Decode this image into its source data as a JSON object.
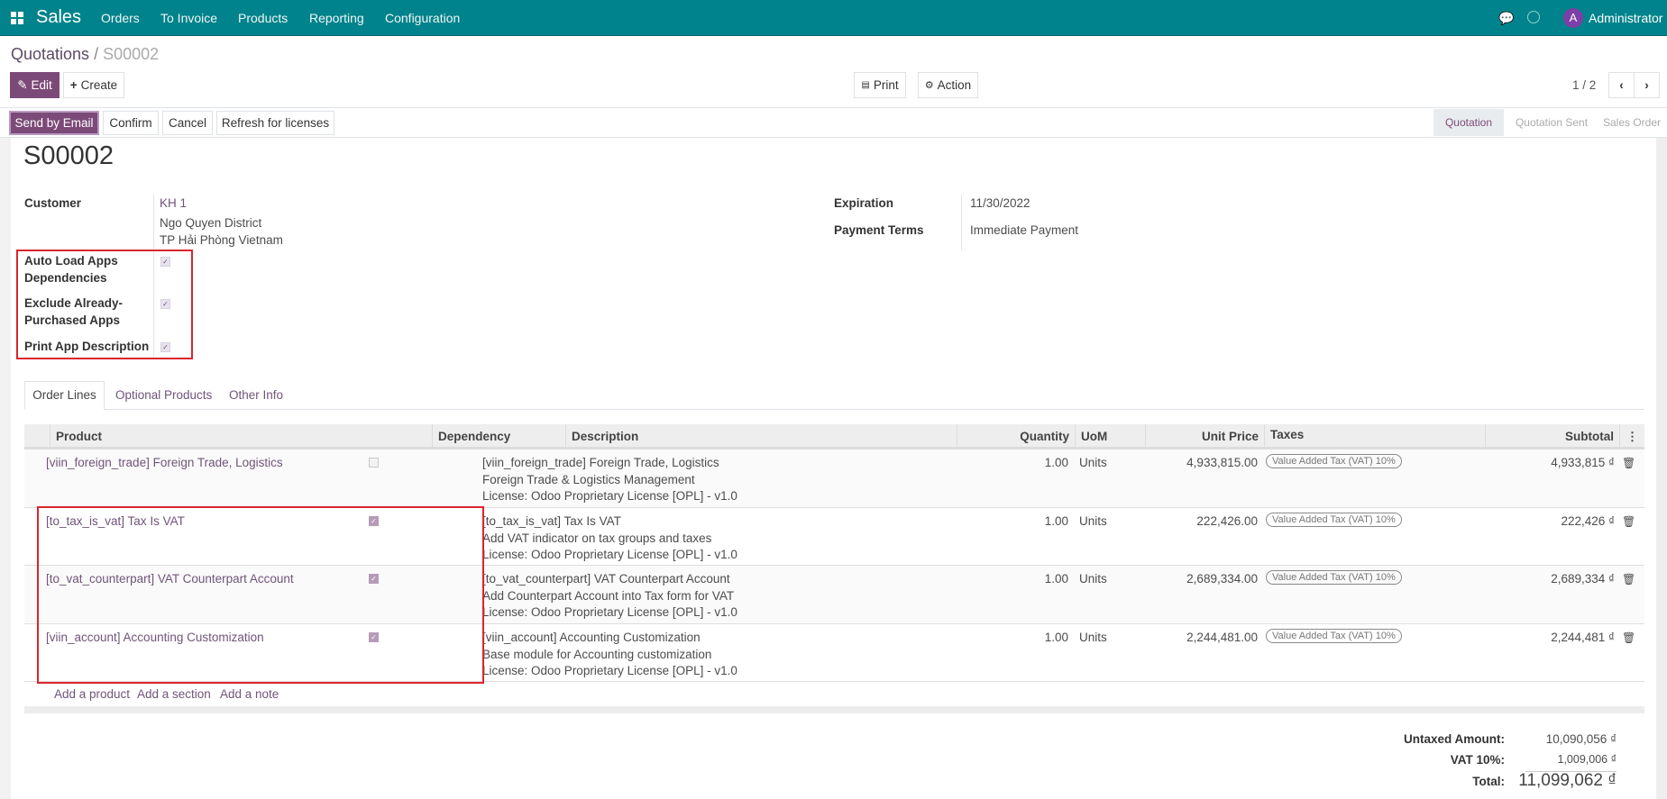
{
  "nav": {
    "app": "Sales",
    "menu": [
      "Orders",
      "To Invoice",
      "Products",
      "Reporting",
      "Configuration"
    ],
    "avatar_letter": "A",
    "user": "Administrator",
    "icons": [
      "apps-grid-icon",
      "chat-icon",
      "clock-icon"
    ]
  },
  "breadcrumb": {
    "parent": "Quotations",
    "sep": "/",
    "current": "S00002"
  },
  "toolbar": {
    "edit": "Edit",
    "create": "Create",
    "print": "Print",
    "action": "Action",
    "pager": "1 / 2"
  },
  "statusbar": {
    "buttons": [
      "Send by Email",
      "Confirm",
      "Cancel",
      "Refresh for licenses"
    ],
    "stages": [
      "Quotation",
      "Quotation Sent",
      "Sales Order"
    ],
    "active_stage": "Quotation"
  },
  "form": {
    "title": "S00002",
    "customer_label": "Customer",
    "customer": "KH 1",
    "address1": "Ngo Quyen District",
    "address2": "TP Hải Phòng Vietnam",
    "auto_load_label1": "Auto Load Apps",
    "auto_load_label2": "Dependencies",
    "auto_load": true,
    "exclude_label1": "Exclude Already-",
    "exclude_label2": "Purchased Apps",
    "exclude": true,
    "print_desc_label": "Print App Description",
    "print_desc": true,
    "expiration_label": "Expiration",
    "expiration": "11/30/2022",
    "payment_terms_label": "Payment Terms",
    "payment_terms": "Immediate Payment"
  },
  "tabs": [
    "Order Lines",
    "Optional Products",
    "Other Info"
  ],
  "table": {
    "headers": [
      "Product",
      "Dependency",
      "Description",
      "Quantity",
      "UoM",
      "Unit Price",
      "Taxes",
      "Subtotal"
    ],
    "rows": [
      {
        "product": "[viin_foreign_trade] Foreign Trade, Logistics",
        "dependency": false,
        "desc": [
          "[viin_foreign_trade] Foreign Trade, Logistics",
          "Foreign Trade & Logistics Management",
          "License: Odoo Proprietary License [OPL] - v1.0"
        ],
        "qty": "1.00",
        "uom": "Units",
        "price": "4,933,815.00",
        "tax": "Value Added Tax (VAT) 10%",
        "subtotal": "4,933,815 ₫"
      },
      {
        "product": "[to_tax_is_vat] Tax Is VAT",
        "dependency": true,
        "desc": [
          "[to_tax_is_vat] Tax Is VAT",
          "Add VAT indicator on tax groups and taxes",
          "License: Odoo Proprietary License [OPL] - v1.0"
        ],
        "qty": "1.00",
        "uom": "Units",
        "price": "222,426.00",
        "tax": "Value Added Tax (VAT) 10%",
        "subtotal": "222,426 ₫"
      },
      {
        "product": "[to_vat_counterpart] VAT Counterpart Account",
        "dependency": true,
        "desc": [
          "[to_vat_counterpart] VAT Counterpart Account",
          "Add Counterpart Account into Tax form for VAT",
          "License: Odoo Proprietary License [OPL] - v1.0"
        ],
        "qty": "1.00",
        "uom": "Units",
        "price": "2,689,334.00",
        "tax": "Value Added Tax (VAT) 10%",
        "subtotal": "2,689,334 ₫"
      },
      {
        "product": "[viin_account] Accounting Customization",
        "dependency": true,
        "desc": [
          "[viin_account] Accounting Customization",
          "Base module for Accounting customization",
          "License: Odoo Proprietary License [OPL] - v1.0"
        ],
        "qty": "1.00",
        "uom": "Units",
        "price": "2,244,481.00",
        "tax": "Value Added Tax (VAT) 10%",
        "subtotal": "2,244,481 ₫"
      }
    ],
    "add_links": [
      "Add a product",
      "Add a section",
      "Add a note"
    ]
  },
  "totals": {
    "untaxed_label": "Untaxed Amount:",
    "untaxed": "10,090,056 ₫",
    "vat_label": "VAT 10%:",
    "vat": "1,009,006 ₫",
    "total_label": "Total:",
    "total": "11,099,062 ₫"
  },
  "colors": {
    "navbar": "#00838c",
    "primary": "#7c4a78",
    "highlight": "#d9262c"
  }
}
